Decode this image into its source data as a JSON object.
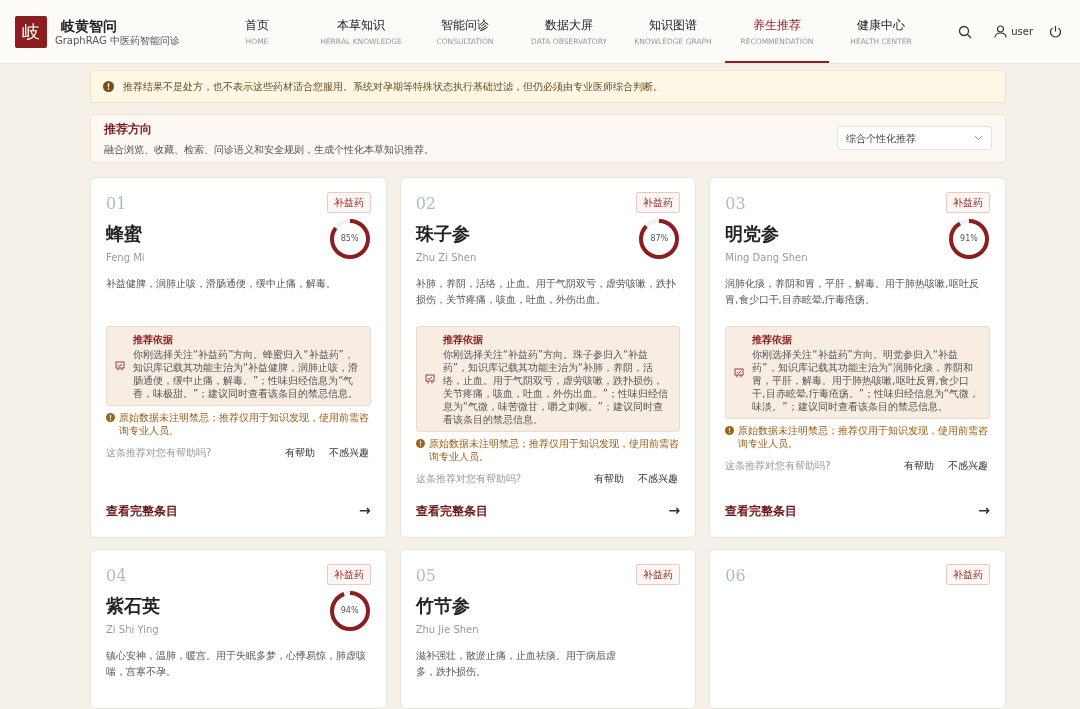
{
  "brand": {
    "logo": "岐",
    "name": "岐黄智问",
    "subtitle": "GraphRAG 中医药智能问诊"
  },
  "nav": [
    {
      "label": "首页",
      "sub": "HOME",
      "selected": false
    },
    {
      "label": "本草知识",
      "sub": "HERBAL KNOWLEDGE",
      "selected": false
    },
    {
      "label": "智能问诊",
      "sub": "CONSULTATION",
      "selected": false
    },
    {
      "label": "数据大屏",
      "sub": "DATA OBSERVATORY",
      "selected": false
    },
    {
      "label": "知识图谱",
      "sub": "KNOWLEDGE GRAPH",
      "selected": false
    },
    {
      "label": "养生推荐",
      "sub": "RECOMMENDATION",
      "selected": true
    },
    {
      "label": "健康中心",
      "sub": "HEALTH CENTER",
      "selected": false
    }
  ],
  "user": "user",
  "notice": "推荐结果不是处方，也不表示这些药材适合您服用。系统对孕期等特殊状态执行基础过滤，但仍必须由专业医师综合判断。",
  "direction": {
    "title": "推荐方向",
    "description": "融合浏览、收藏、检索、问诊语义和安全规则，生成个性化本草知识推荐。",
    "select": "综合个性化推荐"
  },
  "cards": [
    {
      "index": "01",
      "tag": "补益药",
      "name": "蜂蜜",
      "pinyin": "Feng Mi",
      "score": "85%",
      "level": 0.85,
      "description": [
        "补益健脾，润肺止咳，滑肠通便，缓中止痛，解毒。"
      ],
      "basis_title": "推荐依据",
      "basis": "你刚选择关注“补益药”方向。蜂蜜归入“补益药”，知识库记载其功能主治为“补益健脾，润肺止咳，滑肠通便，缓中止痛，解毒。”；性味归经信息为“气香，味极甜。”；建议同时查看该条目的禁忌信息。",
      "warning": "原始数据未注明禁忌；推荐仅用于知识发现，使用前需咨询专业人员。",
      "feedback_question": "这条推荐对您有帮助吗?",
      "helpful": "有帮助",
      "not_interested": "不感兴趣",
      "link": "查看完整条目",
      "arrow": "→"
    },
    {
      "index": "02",
      "tag": "补益药",
      "name": "珠子参",
      "pinyin": "Zhu Zi Shen",
      "score": "87%",
      "level": 0.87,
      "description": [
        "补肺，养阴，活络，止血。用于气阴双亏，虚劳咳嗽，跌扑损伤，关节疼痛，咳血，吐血，外伤出血。"
      ],
      "basis_title": "推荐依据",
      "basis": "你刚选择关注“补益药”方向。珠子参归入“补益药”，知识库记载其功能主治为“补肺，养阴，活络，止血。用于气阴双亏，虚劳咳嗽，跌扑损伤，关节疼痛，咳血，吐血，外伤出血。”；性味归经信息为“气微，味苦微甘，嚼之刺喉。”；建议同时查看该条目的禁忌信息。",
      "warning": "原始数据未注明禁忌；推荐仅用于知识发现，使用前需咨询专业人员。",
      "feedback_question": "这条推荐对您有帮助吗?",
      "helpful": "有帮助",
      "not_interested": "不感兴趣",
      "link": "查看完整条目",
      "arrow": "→"
    },
    {
      "index": "03",
      "tag": "补益药",
      "name": "明党参",
      "pinyin": "Ming Dang Shen",
      "score": "91%",
      "level": 0.91,
      "description": [
        "润肺化痰，养阴和胃，平肝，解毒。用于肺热咳嗽,呕吐反胃,食少口干,目赤眩晕,疔毒疮疡。"
      ],
      "basis_title": "推荐依据",
      "basis": "你刚选择关注“补益药”方向。明党参归入“补益药”，知识库记载其功能主治为“润肺化痰，养阴和胃，平肝，解毒。用于肺热咳嗽,呕吐反胃,食少口干,目赤眩晕,疔毒疮疡。”；性味归经信息为“气微，味淡。”；建议同时查看该条目的禁忌信息。",
      "warning": "原始数据未注明禁忌；推荐仅用于知识发现，使用前需咨询专业人员。",
      "feedback_question": "这条推荐对您有帮助吗?",
      "helpful": "有帮助",
      "not_interested": "不感兴趣",
      "link": "查看完整条目",
      "arrow": "→"
    },
    {
      "index": "04",
      "tag": "补益药",
      "name": "紫石英",
      "pinyin": "Zi Shi Ying",
      "score": "94%",
      "level": 0.94,
      "description": [
        "镇心安神，温肺，暖宫。用于失眠多梦，心悸易惊，肺虚咳喘，宫寒不孕。"
      ]
    },
    {
      "index": "05",
      "tag": "补益药",
      "name": "竹节参",
      "pinyin": "Zhu Jie Shen",
      "description": [
        "滋补强壮，散淤止痛，止血祛痰。用于病后虚",
        "多，跌扑损伤。"
      ]
    },
    {
      "index": "06",
      "tag": "补益药"
    }
  ]
}
